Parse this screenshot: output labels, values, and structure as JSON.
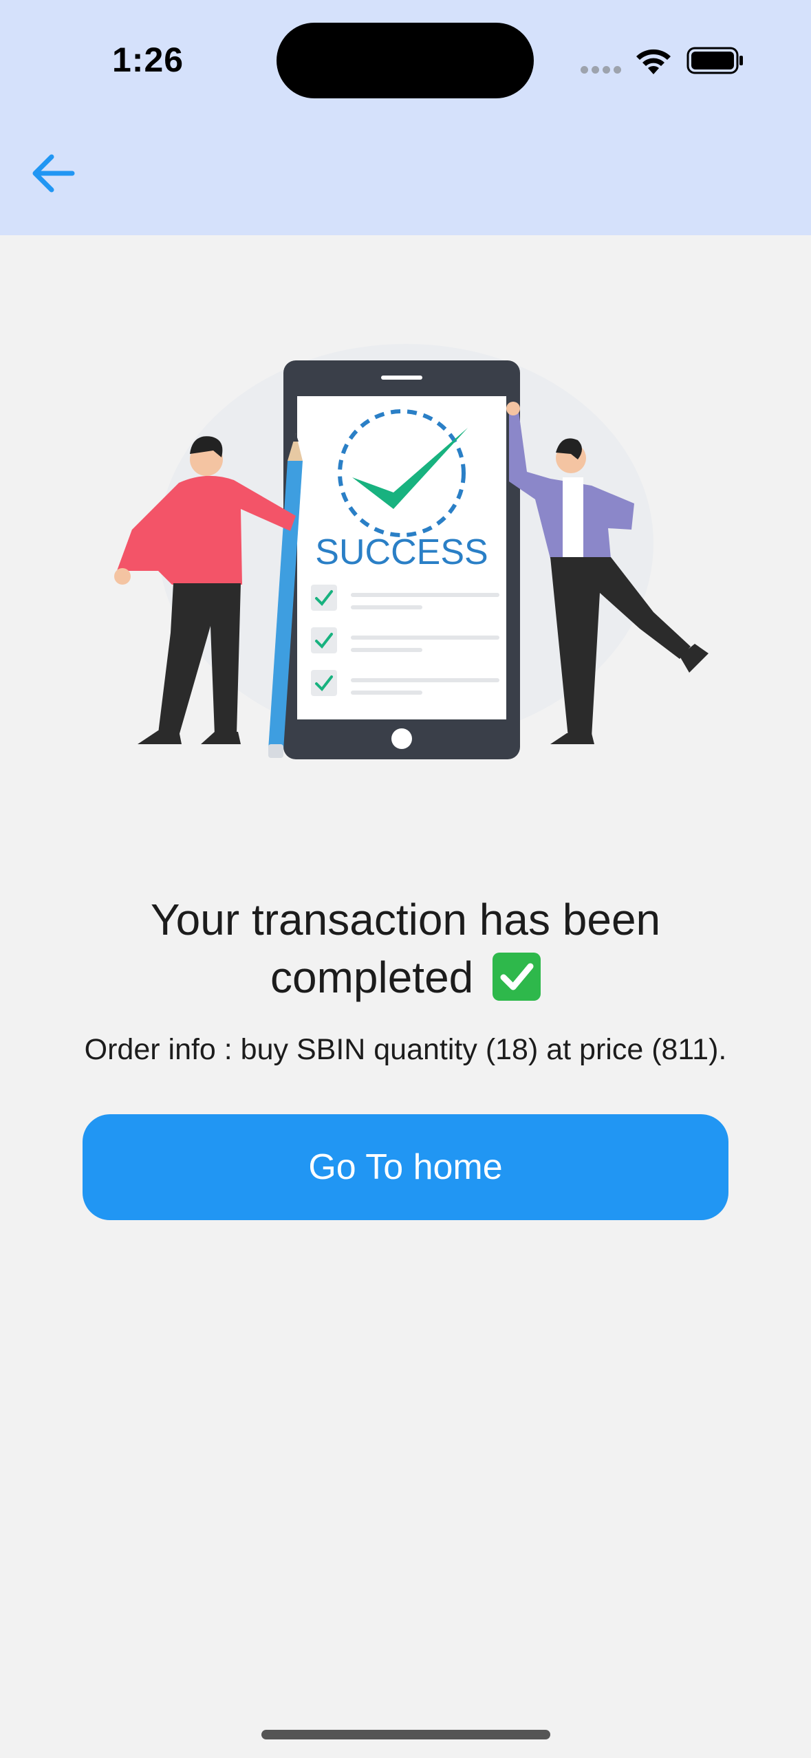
{
  "status_bar": {
    "time": "1:26"
  },
  "header": {
    "back_icon": "arrow-left-icon",
    "accent_color": "#2196f3",
    "background_color": "#d5e1fb"
  },
  "illustration": {
    "success_label": "SUCCESS"
  },
  "message": {
    "title_line1": "Your transaction has been",
    "title_line2": "completed",
    "title_emoji_icon": "check-mark-button-icon",
    "order_info": "Order info : buy SBIN quantity (18) at price (811)."
  },
  "actions": {
    "go_home_label": "Go To home",
    "button_color": "#2196f3"
  }
}
